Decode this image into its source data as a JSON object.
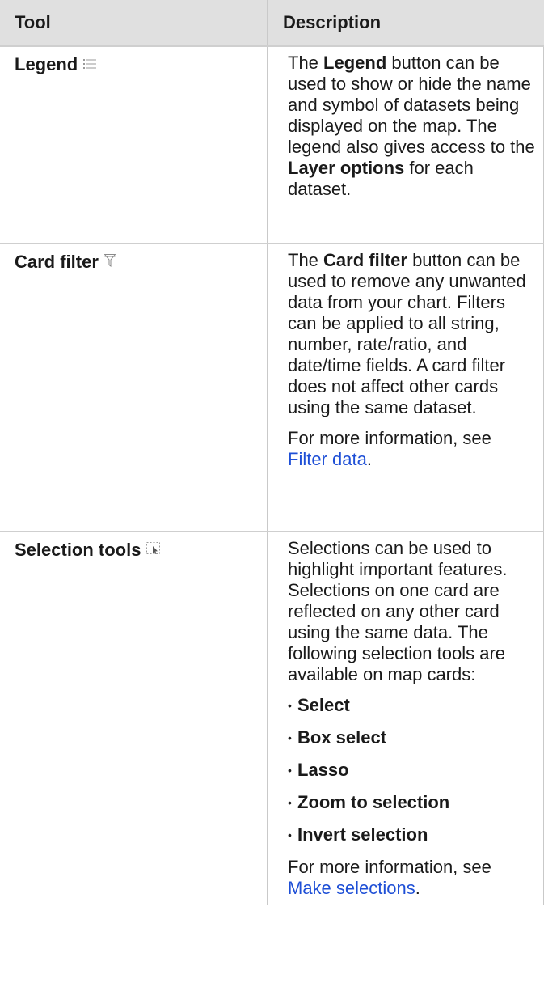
{
  "headers": {
    "tool": "Tool",
    "description": "Description"
  },
  "rows": [
    {
      "tool": "Legend",
      "icon": "legend-list-icon",
      "desc": {
        "p1_a": "The ",
        "p1_b": "Legend",
        "p1_c": " button can be used to show or hide the name and symbol of datasets being displayed on the map. The legend also gives access to the ",
        "p1_d": "Layer options",
        "p1_e": " for each dataset."
      }
    },
    {
      "tool": "Card filter",
      "icon": "funnel-filter-icon",
      "desc": {
        "p1_a": "The ",
        "p1_b": "Card filter",
        "p1_c": " button can be used to remove any unwanted data from your chart. Filters can be applied to all string, number, rate/ratio, and date/time fields. A card filter does not affect other cards using the same dataset.",
        "p2_a": "For more information, see ",
        "p2_link": "Filter data",
        "p2_b": "."
      }
    },
    {
      "tool": "Selection tools",
      "icon": "selection-cursor-icon",
      "desc": {
        "p1": "Selections can be used to highlight important features. Selections on one card are reflected on any other card using the same data. The following selection tools are available on map cards:",
        "bullets": [
          "Select",
          "Box select",
          "Lasso",
          "Zoom to selection",
          "Invert selection"
        ],
        "p2_a": "For more information, see ",
        "p2_link": "Make selections",
        "p2_b": "."
      }
    }
  ],
  "colors": {
    "header_bg": "#e0e0e0",
    "link": "#1e4fd6",
    "border": "#c9c9c9"
  }
}
